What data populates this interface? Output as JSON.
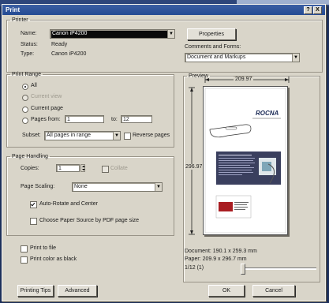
{
  "dialog": {
    "title": "Print",
    "help_glyph": "?",
    "close_glyph": "X"
  },
  "printer": {
    "group_title": "Printer",
    "name_label": "Name:",
    "name_value": "Canon iP4200",
    "status_label": "Status:",
    "status_value": "Ready",
    "type_label": "Type:",
    "type_value": "Canon iP4200",
    "properties_button": "Properties",
    "comments_label": "Comments and Forms:",
    "comments_value": "Document and Markups"
  },
  "print_range": {
    "group_title": "Print Range",
    "all": "All",
    "current_view": "Current view",
    "current_page": "Current page",
    "pages_from": "Pages from:",
    "from_value": "1",
    "to_label": "to:",
    "to_value": "12",
    "subset_label": "Subset:",
    "subset_value": "All pages in range",
    "reverse_pages": "Reverse pages"
  },
  "page_handling": {
    "group_title": "Page Handling",
    "copies_label": "Copies:",
    "copies_value": "1",
    "collate": "Collate",
    "scaling_label": "Page Scaling:",
    "scaling_value": "None",
    "auto_rotate": "Auto-Rotate and Center",
    "choose_paper": "Choose Paper Source by PDF page size"
  },
  "options": {
    "print_to_file": "Print to file",
    "print_color_black": "Print color as black"
  },
  "preview": {
    "group_title": "Preview",
    "width_dim": "209.97",
    "height_dim": "296.97",
    "document_size": "Document: 190.1 x 259.3 mm",
    "paper_size": "Paper: 209.9 x 296.7 mm",
    "page_counter": "1/12 (1)",
    "page_logo": "ROCNA"
  },
  "buttons": {
    "printing_tips": "Printing Tips",
    "advanced": "Advanced",
    "ok": "OK",
    "cancel": "Cancel"
  }
}
